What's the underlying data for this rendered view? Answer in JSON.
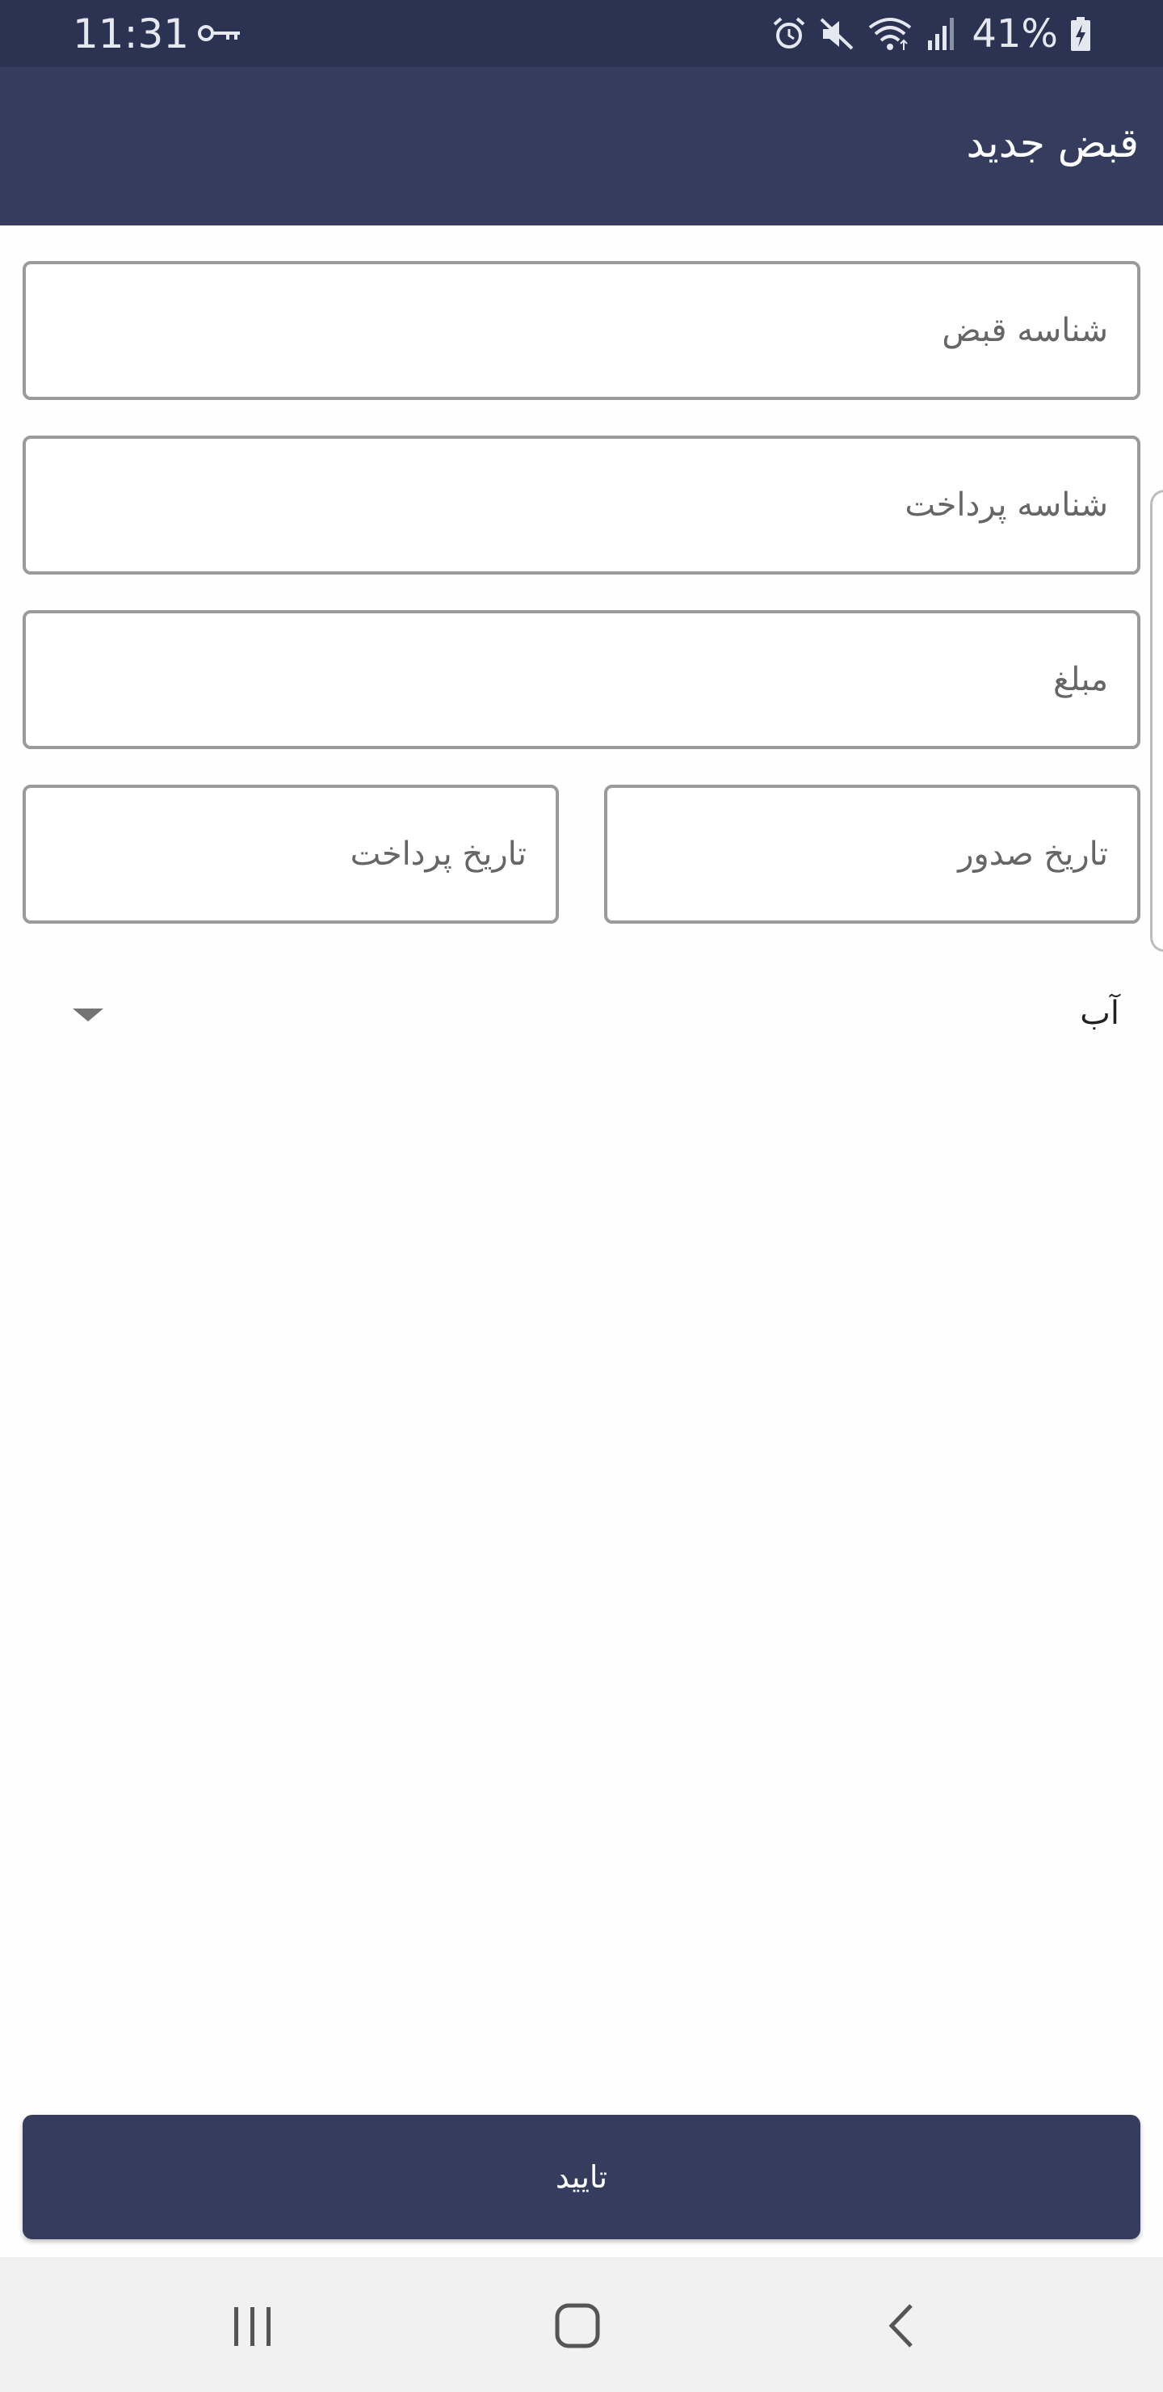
{
  "status_bar": {
    "time": "11:31",
    "battery_percent": "41%",
    "icons": [
      "vpn-key-icon",
      "alarm-icon",
      "mute-icon",
      "wifi-icon",
      "signal-icon",
      "battery-charging-icon"
    ]
  },
  "app_bar": {
    "title": "قبض جدید"
  },
  "form": {
    "bill_id_placeholder": "شناسه قبض",
    "payment_id_placeholder": "شناسه پرداخت",
    "amount_placeholder": "مبلغ",
    "issue_date_placeholder": "تاریخ صدور",
    "payment_date_placeholder": "تاریخ پرداخت",
    "bill_type": {
      "selected": "آب"
    }
  },
  "submit_label": "تایید",
  "nav_bar": {
    "icons": [
      "recent-apps-icon",
      "home-icon",
      "back-icon"
    ]
  },
  "colors": {
    "status_bar_bg": "#2b3252",
    "app_bar_bg": "#363c5e",
    "button_bg": "#363c5e",
    "nav_bar_bg": "#f1f1f1"
  }
}
